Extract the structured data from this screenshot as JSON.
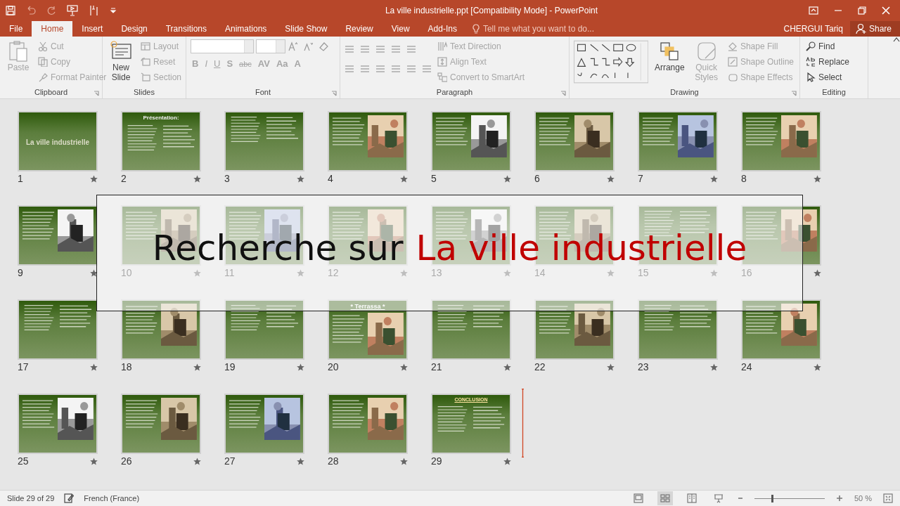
{
  "window": {
    "title": "La ville industrielle.ppt [Compatibility Mode] - PowerPoint"
  },
  "tabs": [
    {
      "label": "File",
      "selected": false
    },
    {
      "label": "Home",
      "selected": true
    },
    {
      "label": "Insert",
      "selected": false
    },
    {
      "label": "Design",
      "selected": false
    },
    {
      "label": "Transitions",
      "selected": false
    },
    {
      "label": "Animations",
      "selected": false
    },
    {
      "label": "Slide Show",
      "selected": false
    },
    {
      "label": "Review",
      "selected": false
    },
    {
      "label": "View",
      "selected": false
    },
    {
      "label": "Add-Ins",
      "selected": false
    }
  ],
  "tell_me": {
    "placeholder": "Tell me what you want to do..."
  },
  "user": "CHERGUI Tariq",
  "share": "Share",
  "ribbon": {
    "groups": [
      {
        "label": "Clipboard",
        "launcher": true,
        "large": [
          {
            "label": "Paste",
            "disabled": true
          }
        ],
        "small": [
          {
            "label": "Cut",
            "disabled": true
          },
          {
            "label": "Copy",
            "disabled": true
          },
          {
            "label": "Format Painter",
            "disabled": true
          }
        ]
      },
      {
        "label": "Slides",
        "large": [
          {
            "label": "New Slide",
            "disabled": false
          }
        ],
        "small": [
          {
            "label": "Layout",
            "disabled": true
          },
          {
            "label": "Reset",
            "disabled": true
          },
          {
            "label": "Section",
            "disabled": true
          }
        ]
      },
      {
        "label": "Font",
        "launcher": true,
        "format_buttons": [
          "B",
          "I",
          "U",
          "S",
          "abc",
          "AV",
          "Aa",
          "A"
        ]
      },
      {
        "label": "Paragraph",
        "launcher": true,
        "small": [
          {
            "label": "Text Direction",
            "disabled": true
          },
          {
            "label": "Align Text",
            "disabled": true
          },
          {
            "label": "Convert to SmartArt",
            "disabled": true
          }
        ]
      },
      {
        "label": "Drawing",
        "launcher": true,
        "large": [
          {
            "label": "Arrange",
            "disabled": false
          },
          {
            "label": "Quick Styles",
            "disabled": true
          }
        ],
        "small": [
          {
            "label": "Shape Fill",
            "disabled": true
          },
          {
            "label": "Shape Outline",
            "disabled": true
          },
          {
            "label": "Shape Effects",
            "disabled": true
          }
        ]
      },
      {
        "label": "Editing",
        "small": [
          {
            "label": "Find",
            "disabled": false
          },
          {
            "label": "Replace",
            "disabled": false
          },
          {
            "label": "Select",
            "disabled": false
          }
        ]
      }
    ]
  },
  "slides": [
    {
      "number": "1",
      "kind": "title",
      "title": "La ville industrielle"
    },
    {
      "number": "2",
      "kind": "content",
      "title": "Présentation:"
    },
    {
      "number": "3",
      "kind": "content"
    },
    {
      "number": "4",
      "kind": "content",
      "picture": true
    },
    {
      "number": "5",
      "kind": "content",
      "picture": true
    },
    {
      "number": "6",
      "kind": "content",
      "picture": true
    },
    {
      "number": "7",
      "kind": "content",
      "picture": true
    },
    {
      "number": "8",
      "kind": "content",
      "picture": true
    },
    {
      "number": "9",
      "kind": "content",
      "picture": true
    },
    {
      "number": "10",
      "kind": "content",
      "picture": true
    },
    {
      "number": "11",
      "kind": "content",
      "picture": true
    },
    {
      "number": "12",
      "kind": "content",
      "picture": true
    },
    {
      "number": "13",
      "kind": "content",
      "picture": true
    },
    {
      "number": "14",
      "kind": "content",
      "picture": true
    },
    {
      "number": "15",
      "kind": "content"
    },
    {
      "number": "16",
      "kind": "content",
      "picture": true
    },
    {
      "number": "17",
      "kind": "content"
    },
    {
      "number": "18",
      "kind": "content",
      "picture": true
    },
    {
      "number": "19",
      "kind": "content"
    },
    {
      "number": "20",
      "kind": "content",
      "title": "* Terrassa *",
      "picture": true
    },
    {
      "number": "21",
      "kind": "content"
    },
    {
      "number": "22",
      "kind": "content",
      "picture": true
    },
    {
      "number": "23",
      "kind": "content"
    },
    {
      "number": "24",
      "kind": "content",
      "picture": true
    },
    {
      "number": "25",
      "kind": "content",
      "picture": true
    },
    {
      "number": "26",
      "kind": "content",
      "picture": true
    },
    {
      "number": "27",
      "kind": "content",
      "picture": true
    },
    {
      "number": "28",
      "kind": "content",
      "picture": true
    },
    {
      "number": "29",
      "kind": "content",
      "title": "CONCLUSION"
    }
  ],
  "banner": {
    "text": "Recherche sur",
    "highlight": "La ville industrielle"
  },
  "status_bar": {
    "slide": "Slide 29 of 29",
    "language": "French (France)",
    "zoom": {
      "level": 0.24,
      "reading": "50 %"
    }
  }
}
